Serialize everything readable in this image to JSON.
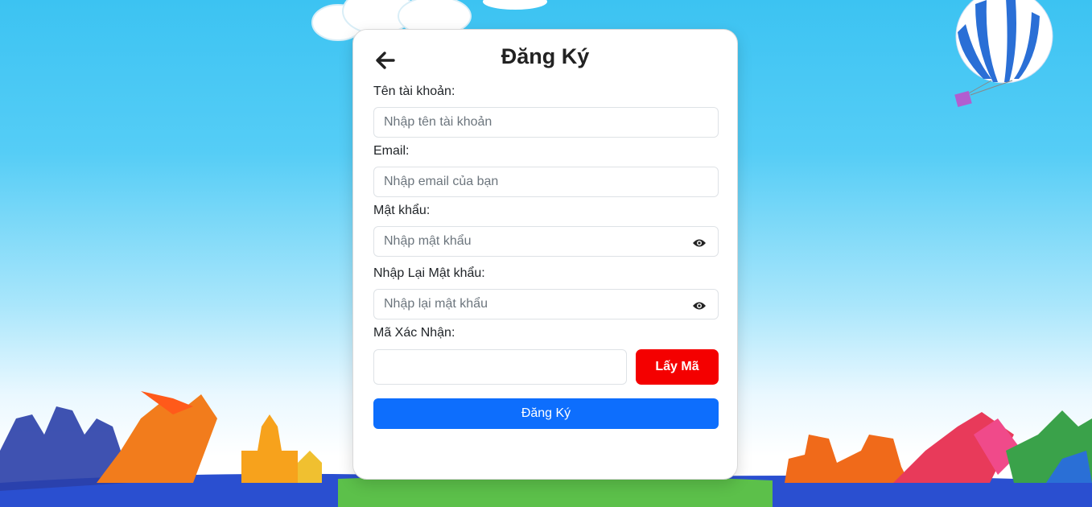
{
  "form": {
    "title": "Đăng Ký",
    "username": {
      "label": "Tên tài khoản:",
      "placeholder": "Nhập tên tài khoản",
      "value": ""
    },
    "email": {
      "label": "Email:",
      "placeholder": "Nhập email của bạn",
      "value": ""
    },
    "password": {
      "label": "Mật khẩu:",
      "placeholder": "Nhập mật khẩu",
      "value": ""
    },
    "confirm_password": {
      "label": "Nhập Lại Mật khẩu:",
      "placeholder": "Nhập lại mật khẩu",
      "value": ""
    },
    "verification": {
      "label": "Mã Xác Nhận:",
      "value": "",
      "button_label": "Lấy Mã"
    },
    "submit_label": "Đăng Ký"
  },
  "icons": {
    "back": "arrow-left-icon",
    "toggle_password": "eye-icon"
  },
  "colors": {
    "primary": "#0d6efd",
    "danger": "#f40000",
    "sky": "#3cc3f2"
  }
}
